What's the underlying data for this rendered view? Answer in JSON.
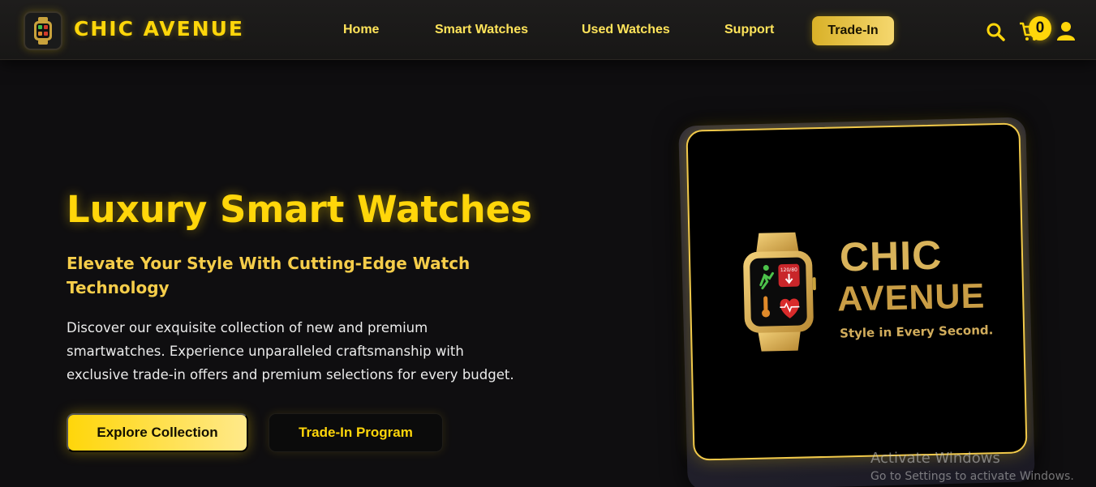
{
  "header": {
    "brand": "CHIC AVENUE",
    "nav": {
      "home": "Home",
      "smart_watches": "Smart Watches",
      "used_watches": "Used Watches",
      "support": "Support",
      "trade_in": "Trade-In"
    },
    "cart_count": "0",
    "icons": [
      "watch-logo-icon",
      "search-icon",
      "cart-icon",
      "user-icon"
    ]
  },
  "hero": {
    "title": "Luxury Smart Watches",
    "subtitle": "Elevate Your Style With Cutting-Edge Watch Technology",
    "description": "Discover our exquisite collection of new and premium smartwatches. Experience unparalleled craftsmanship with exclusive trade-in offers and premium selections for every budget.",
    "primary_button": "Explore Collection",
    "secondary_button": "Trade-In Program"
  },
  "hero_image": {
    "brand_line_1": "CHIC",
    "brand_line_2": "AVENUE",
    "tagline": "Style in Every Second.",
    "watch_readout": "120/80"
  },
  "watermark": {
    "title": "Activate Windows",
    "subtitle": "Go to Settings to activate Windows."
  },
  "colors": {
    "accent": "#ffd60a",
    "background": "#0f0e10",
    "header": "#1e1d1c",
    "gold": "#d9b35a"
  }
}
